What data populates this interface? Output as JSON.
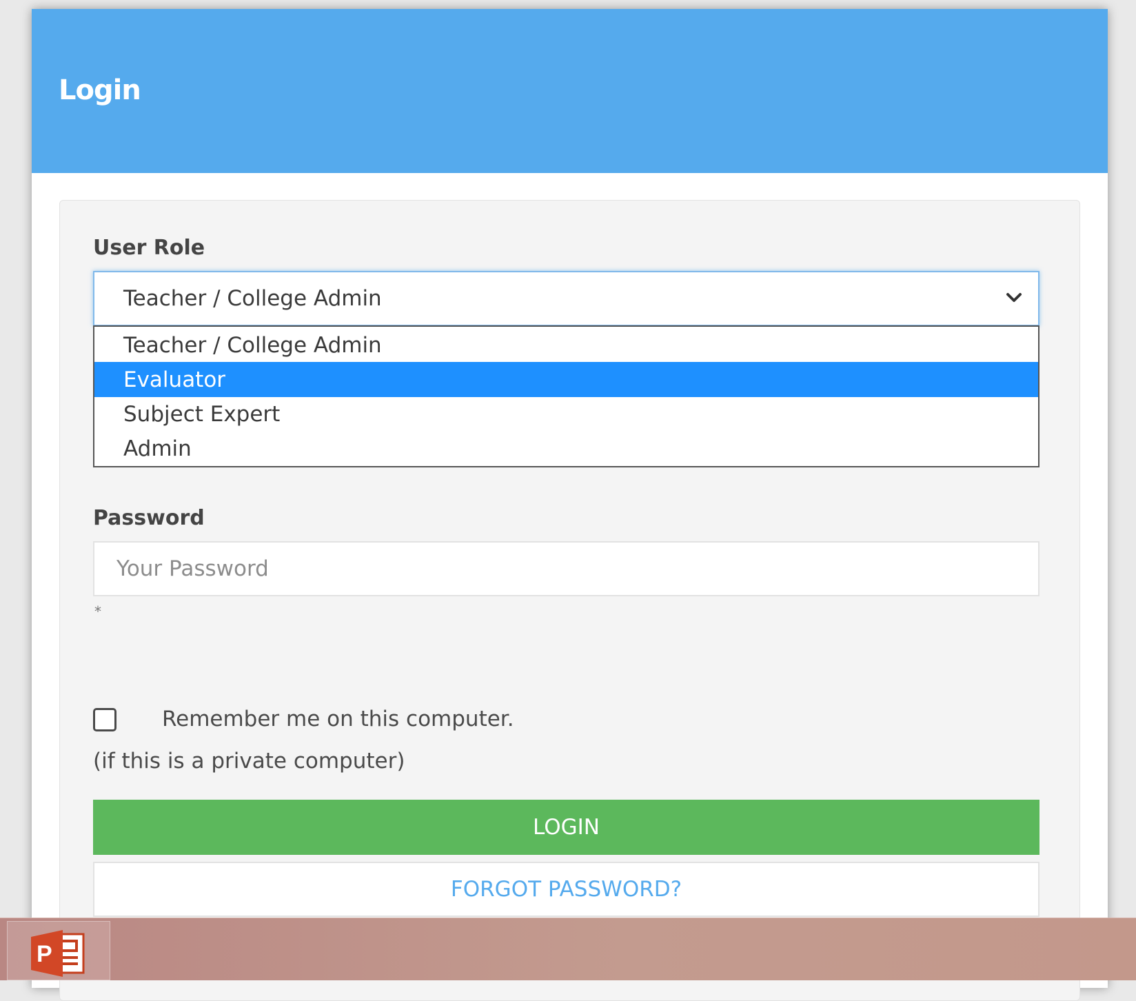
{
  "login": {
    "title": "Login"
  },
  "user_role": {
    "label": "User Role",
    "selected_value": "Teacher / College Admin",
    "options": [
      "Teacher / College Admin",
      "Evaluator",
      "Subject Expert",
      "Admin"
    ],
    "highlighted_option": "Evaluator"
  },
  "password": {
    "label": "Password",
    "placeholder": "Your Password",
    "required_mark": "*"
  },
  "remember": {
    "label": "Remember me on this computer.",
    "note": "(if this is a private computer)"
  },
  "buttons": {
    "login": "LOGIN",
    "forgot_password": "FORGOT PASSWORD?"
  },
  "taskbar": {
    "app_icon": "powerpoint-icon",
    "app_icon_letter": "P"
  },
  "colors": {
    "header": "#55aaed",
    "login_button": "#5cb85c",
    "selected_option": "#1e90ff",
    "taskbar": "#c39b8f"
  }
}
